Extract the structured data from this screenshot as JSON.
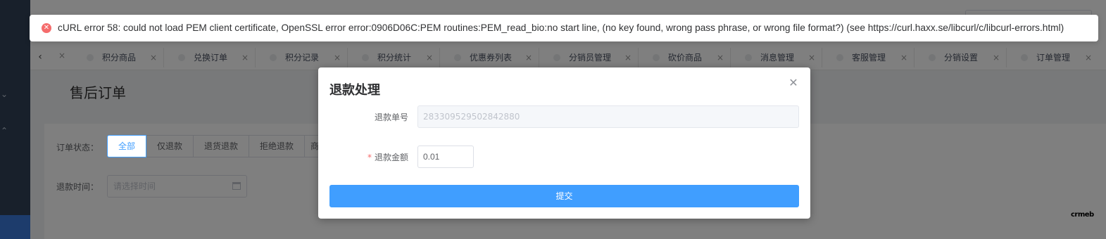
{
  "error": {
    "message": "cURL error 58: could not load PEM client certificate, OpenSSL error error:0906D06C:PEM routines:PEM_read_bio:no start line, (no key found, wrong pass phrase, or wrong file format?) (see https://curl.haxx.se/libcurl/c/libcurl-errors.html)",
    "icon": "error-circle-icon"
  },
  "tabs": [
    {
      "label": "积分商品"
    },
    {
      "label": "兑换订单"
    },
    {
      "label": "积分记录"
    },
    {
      "label": "积分统计"
    },
    {
      "label": "优惠券列表"
    },
    {
      "label": "分销员管理"
    },
    {
      "label": "砍价商品"
    },
    {
      "label": "消息管理"
    },
    {
      "label": "客服管理"
    },
    {
      "label": "分销设置"
    },
    {
      "label": "订单管理"
    }
  ],
  "page": {
    "title": "售后订单",
    "order_status_label": "订单状态：",
    "status_options": [
      "全部",
      "仅退款",
      "退货退款",
      "拒绝退款",
      "商"
    ],
    "refund_time_label": "退款时间：",
    "date_placeholder": "请选择时间"
  },
  "dialog": {
    "title": "退款处理",
    "refund_no_label": "退款单号",
    "refund_no_value": "283309529502842880",
    "required_mark": "*",
    "refund_amount_label": "退款金额",
    "refund_amount_value": "0.01",
    "submit_label": "提交"
  },
  "brand_text": "crmeb",
  "colors": {
    "primary": "#409eff",
    "error": "#f56c6c",
    "sidebar": "#304156"
  }
}
